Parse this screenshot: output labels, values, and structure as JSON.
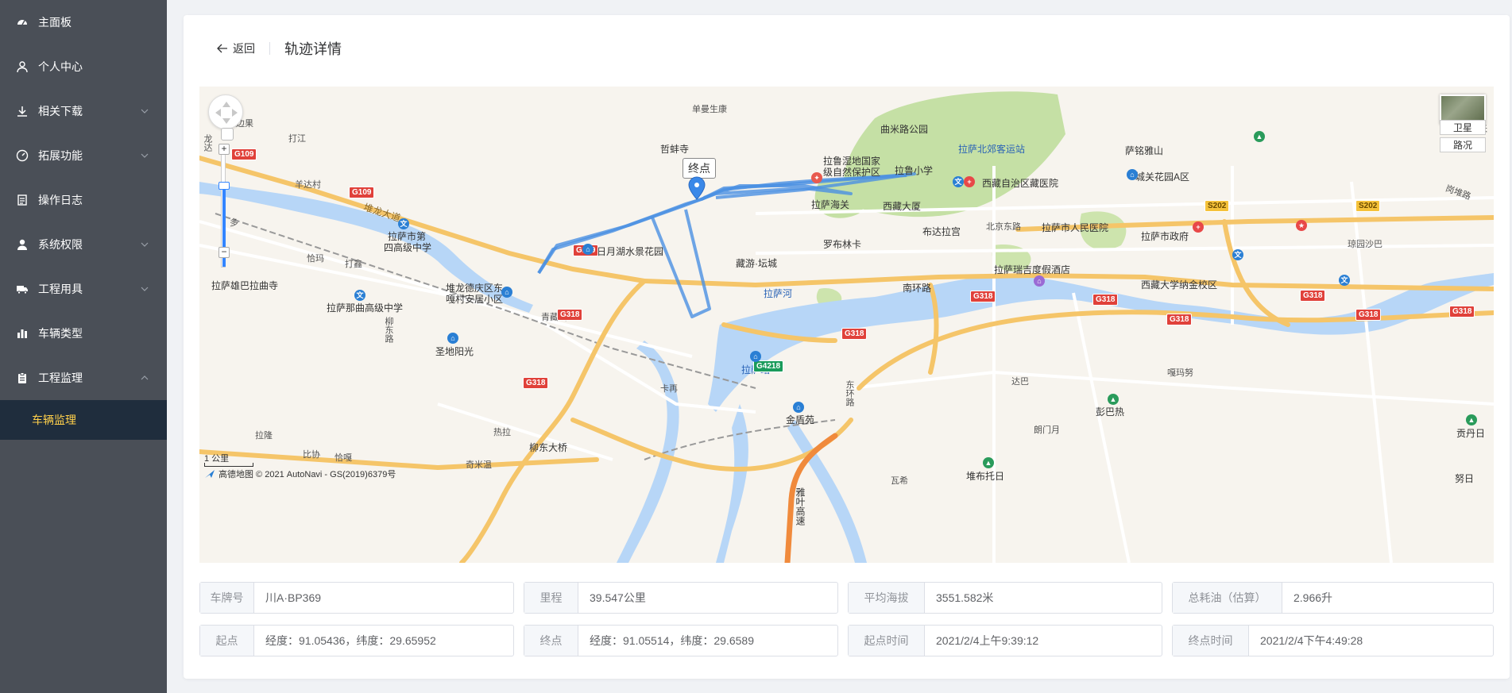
{
  "sidebar": {
    "items": [
      {
        "label": "主面板",
        "icon": "dashboard-icon",
        "has_arrow": false
      },
      {
        "label": "个人中心",
        "icon": "user-icon",
        "has_arrow": false
      },
      {
        "label": "相关下载",
        "icon": "download-icon",
        "has_arrow": true
      },
      {
        "label": "拓展功能",
        "icon": "gauge-icon",
        "has_arrow": true
      },
      {
        "label": "操作日志",
        "icon": "document-icon",
        "has_arrow": false
      },
      {
        "label": "系统权限",
        "icon": "user-fill-icon",
        "has_arrow": true
      },
      {
        "label": "工程用具",
        "icon": "truck-icon",
        "has_arrow": true
      },
      {
        "label": "车辆类型",
        "icon": "bar-chart-icon",
        "has_arrow": false
      },
      {
        "label": "工程监理",
        "icon": "clipboard-icon",
        "has_arrow": true,
        "expanded": true
      }
    ],
    "submenu": [
      {
        "label": "车辆监理",
        "active": true
      }
    ]
  },
  "header": {
    "back_label": "返回",
    "title": "轨迹详情"
  },
  "map": {
    "endpoint_label": "终点",
    "layer_satellite": "卫星",
    "layer_traffic": "路况",
    "scale": "1 公里",
    "copyright": "高德地图 © 2021 AutoNavi - GS(2019)6379号",
    "labels": [
      {
        "t": "单曼生康"
      },
      {
        "t": "哲蚌寺"
      },
      {
        "t": "曲米路公园"
      },
      {
        "t": "拉鲁湿地国家"
      },
      {
        "t": "级自然保护区"
      },
      {
        "t": "拉萨北郊客运站"
      },
      {
        "t": "萨铭雅山"
      },
      {
        "t": "拉鲁小学"
      },
      {
        "t": "西藏自治区藏医院"
      },
      {
        "t": "城关花园A区"
      },
      {
        "t": "拉萨海关"
      },
      {
        "t": "西藏大厦"
      },
      {
        "t": "布达拉宫"
      },
      {
        "t": "北京东路"
      },
      {
        "t": "拉萨市人民医院"
      },
      {
        "t": "拉萨市政府"
      },
      {
        "t": "罗布林卡"
      },
      {
        "t": "藏游·坛城"
      },
      {
        "t": "日月湖水景花园"
      },
      {
        "t": "拉萨瑞吉度假酒店"
      },
      {
        "t": "西藏大学纳金校区"
      },
      {
        "t": "拉萨河"
      },
      {
        "t": "南环路"
      },
      {
        "t": "拉萨市第"
      },
      {
        "t": "四高级中学"
      },
      {
        "t": "堆龙大道"
      },
      {
        "t": "打江"
      },
      {
        "t": "羊达村"
      },
      {
        "t": "恰玛"
      },
      {
        "t": "打鑫"
      },
      {
        "t": "拉萨雄巴拉曲寺"
      },
      {
        "t": "拉萨那曲高级中学"
      },
      {
        "t": "堆龙德庆区东"
      },
      {
        "t": "嘎村安居小区"
      },
      {
        "t": "青藏线"
      },
      {
        "t": "柳东路"
      },
      {
        "t": "圣地阳光"
      },
      {
        "t": "拉萨站"
      },
      {
        "t": "金盾苑"
      },
      {
        "t": "东环路"
      },
      {
        "t": "达巴"
      },
      {
        "t": "嘎玛努"
      },
      {
        "t": "彭巴热"
      },
      {
        "t": "朗门月"
      },
      {
        "t": "贡丹日"
      },
      {
        "t": "堆布托日"
      },
      {
        "t": "热拉"
      },
      {
        "t": "柳东大桥"
      },
      {
        "t": "奇米温"
      },
      {
        "t": "拉隆"
      },
      {
        "t": "比协"
      },
      {
        "t": "恰嘎"
      },
      {
        "t": "雅叶高速"
      },
      {
        "t": "琼园沙巴"
      },
      {
        "t": "岗堆路"
      },
      {
        "t": "米"
      },
      {
        "t": "江边果"
      },
      {
        "t": "龙达"
      },
      {
        "t": "卡再"
      },
      {
        "t": "瓦希"
      },
      {
        "t": "努日"
      },
      {
        "t": "多"
      }
    ],
    "roads": [
      "G109",
      "G318",
      "G4218",
      "S202"
    ]
  },
  "info": {
    "row1": [
      {
        "key": "车牌号",
        "value": "川A·BP369"
      },
      {
        "key": "里程",
        "value": "39.547公里"
      },
      {
        "key": "平均海拔",
        "value": "3551.582米"
      },
      {
        "key": "总耗油（估算）",
        "value": "2.966升"
      }
    ],
    "row2": [
      {
        "key": "起点",
        "value": "经度：91.05436，纬度：29.65952"
      },
      {
        "key": "终点",
        "value": "经度：91.05514，纬度：29.6589"
      },
      {
        "key": "起点时间",
        "value": "2021/2/4上午9:39:12"
      },
      {
        "key": "终点时间",
        "value": "2021/2/4下午4:49:28"
      }
    ]
  },
  "colors": {
    "sidebar_bg": "#4a4f57",
    "submenu_bg": "#1f2d3d",
    "active": "#ffd04b",
    "track": "#4a90e2"
  }
}
